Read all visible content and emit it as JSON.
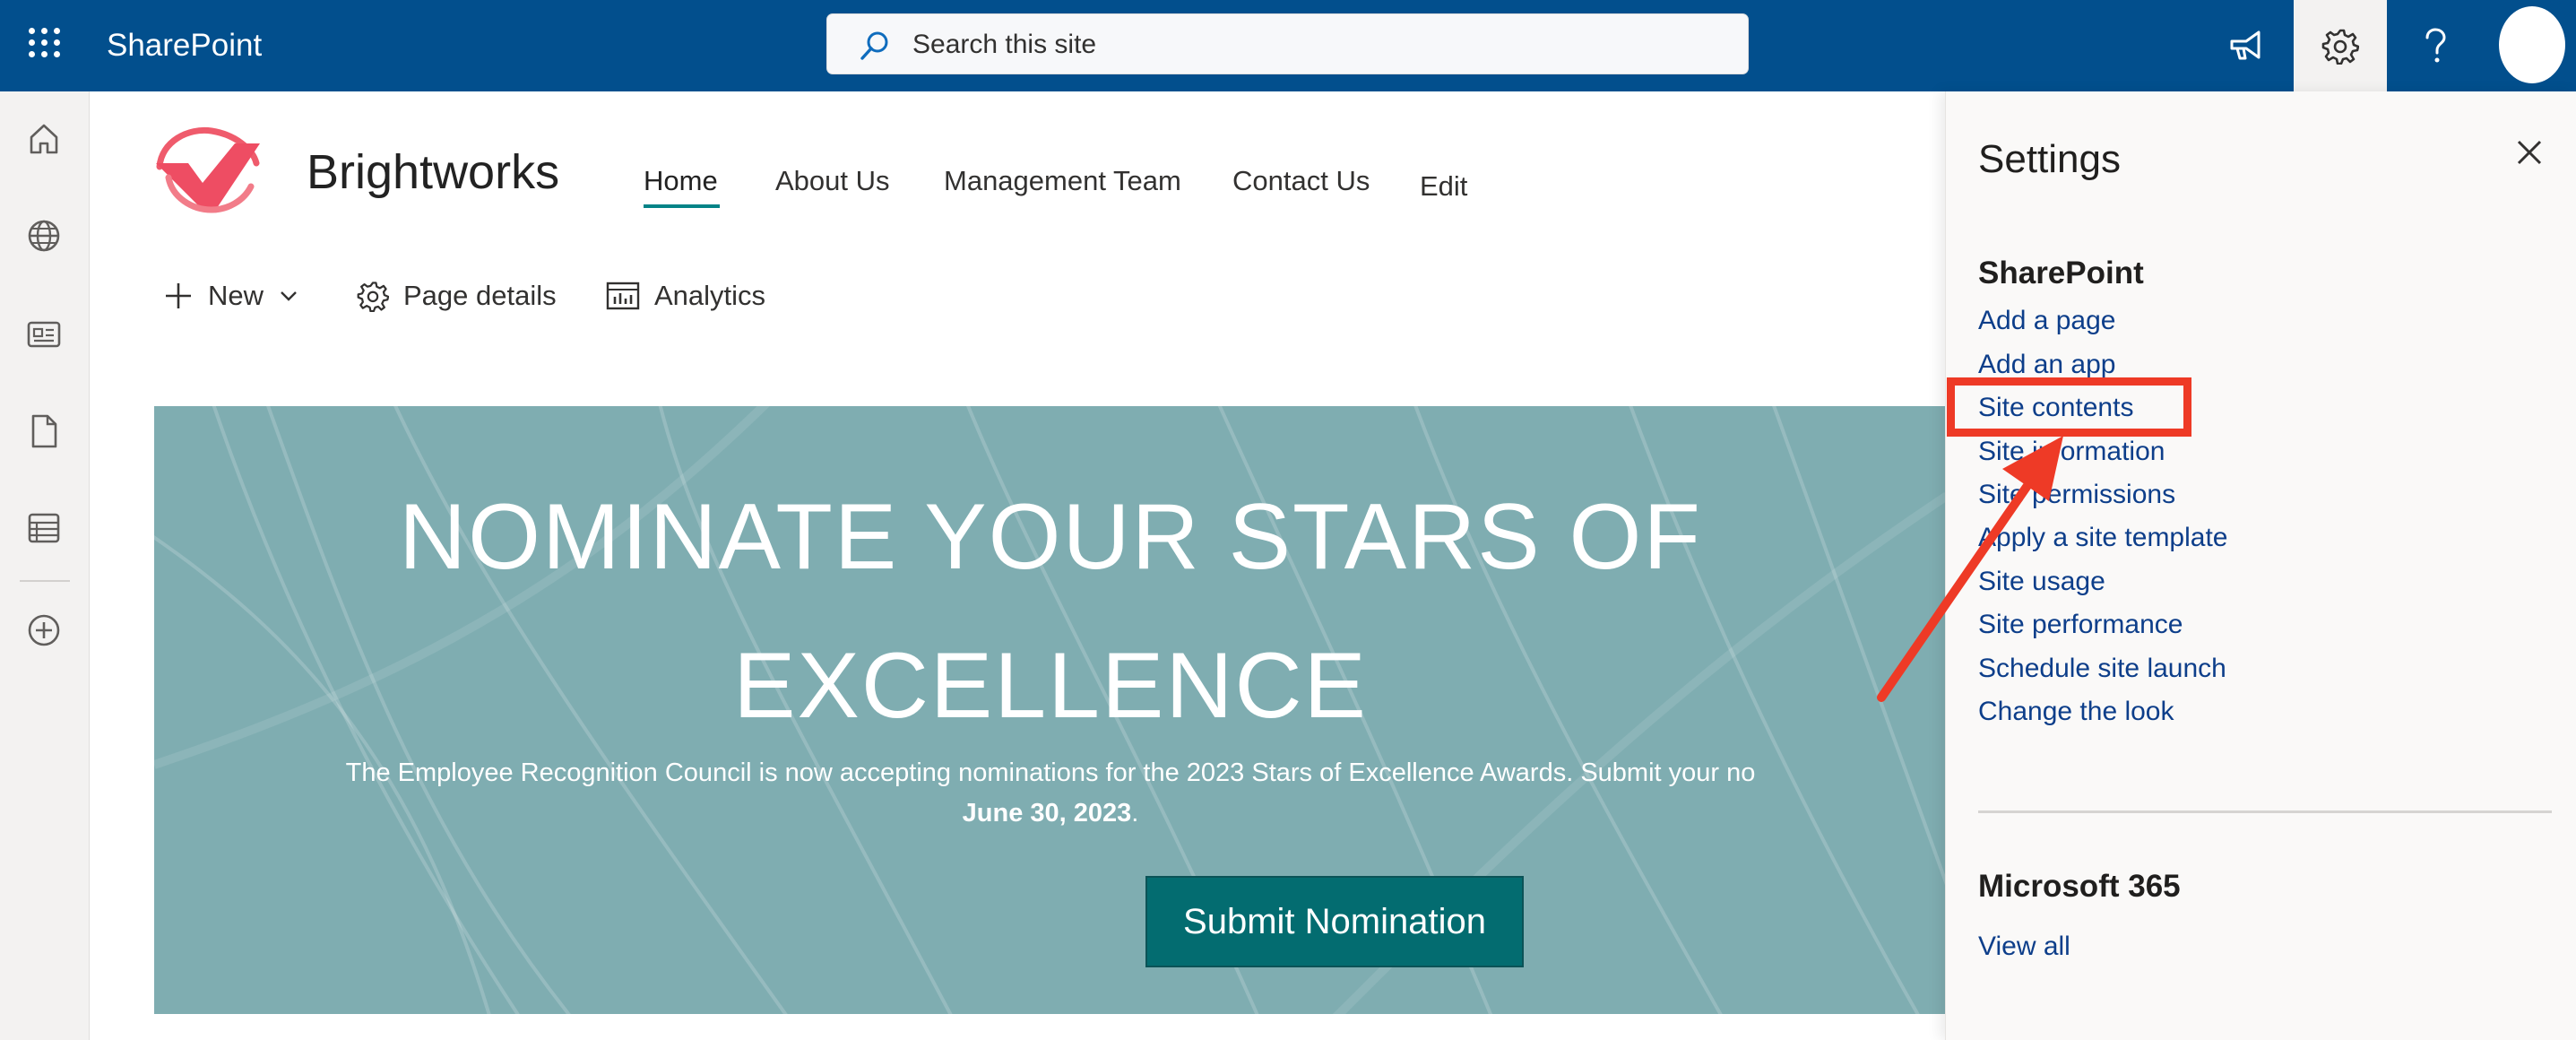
{
  "suitebar": {
    "app_name": "SharePoint",
    "search_placeholder": "Search this site"
  },
  "site": {
    "title": "Brightworks",
    "nav": [
      "Home",
      "About Us",
      "Management Team",
      "Contact Us",
      "Edit"
    ]
  },
  "commandbar": {
    "new_label": "New",
    "page_details_label": "Page details",
    "analytics_label": "Analytics"
  },
  "hero": {
    "heading_line1": "NOMINATE YOUR STARS OF",
    "heading_line2": "EXCELLENCE",
    "body_line1": "The Employee Recognition Council is now accepting nominations for the 2023 Stars of Excellence Awards. Submit your no",
    "body_date": "June 30, 2023",
    "body_suffix": ".",
    "button_label": "Submit Nomination"
  },
  "settings_panel": {
    "title": "Settings",
    "sharepoint_section": "SharePoint",
    "links": [
      "Add a page",
      "Add an app",
      "Site contents",
      "Site information",
      "Site permissions",
      "Apply a site template",
      "Site usage",
      "Site performance",
      "Schedule site launch",
      "Change the look"
    ],
    "m365_section": "Microsoft 365",
    "view_all": "View all"
  },
  "colors": {
    "suitebar": "#024f8d",
    "accent_teal": "#038387",
    "hero_bg": "#7fadb1",
    "button_bg": "#036c70",
    "link_blue": "#0d3e8a",
    "annotation_red": "#ee3a26"
  },
  "icons": {
    "app_launcher": "waffle-icon",
    "search": "search-icon",
    "announcement": "megaphone-icon",
    "settings": "gear-icon",
    "help": "help-icon",
    "close": "close-icon"
  }
}
